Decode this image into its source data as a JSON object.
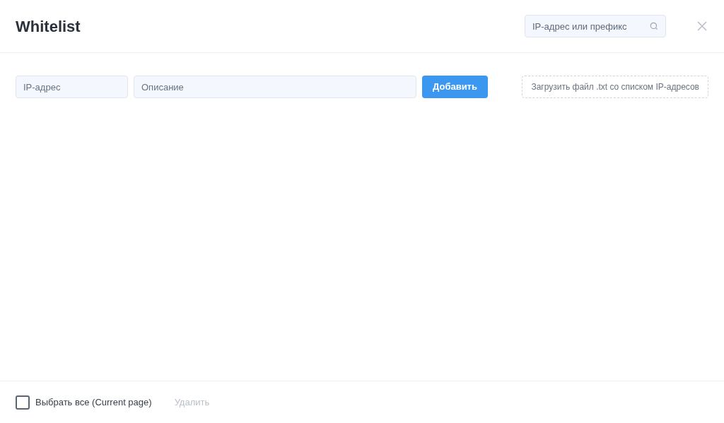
{
  "header": {
    "title": "Whitelist",
    "search": {
      "placeholder": "IP-адрес или префикс"
    }
  },
  "add_form": {
    "ip_field": {
      "placeholder": "IP-адрес"
    },
    "description_field": {
      "placeholder": "Описание"
    },
    "add_button": "Добавить",
    "upload_button": "Загрузить файл .txt со списком IP-адресов"
  },
  "footer": {
    "select_all": {
      "label": "Выбрать все (Current page)",
      "checked": false
    },
    "delete_button": {
      "label": "Удалить",
      "disabled": true
    }
  }
}
